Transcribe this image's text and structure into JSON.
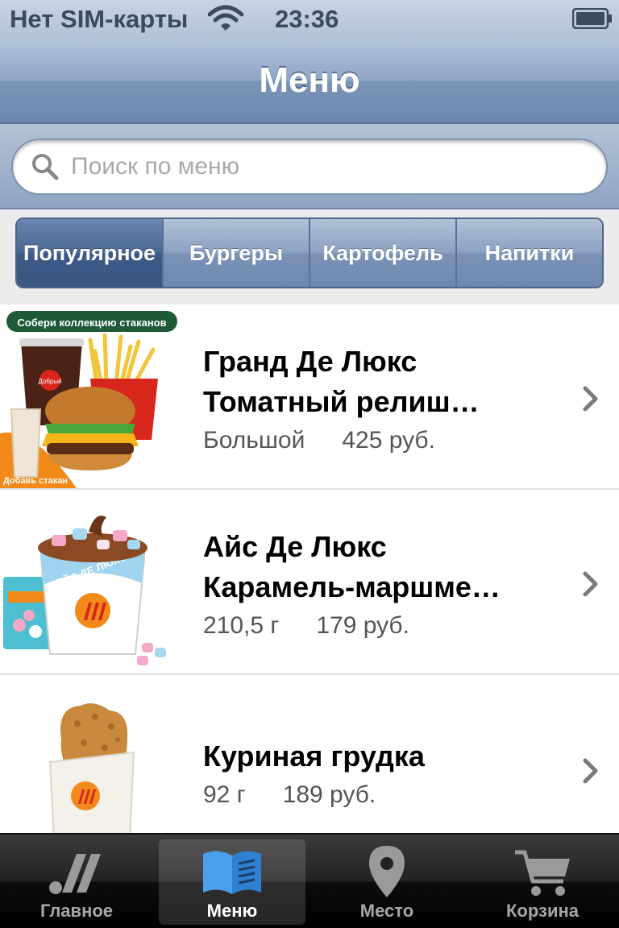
{
  "status": {
    "carrier": "Нет SIM-карты",
    "time": "23:36"
  },
  "nav": {
    "title": "Меню"
  },
  "search": {
    "placeholder": "Поиск по меню"
  },
  "segments": [
    {
      "label": "Популярное",
      "active": true
    },
    {
      "label": "Бургеры",
      "active": false
    },
    {
      "label": "Картофель",
      "active": false
    },
    {
      "label": "Напитки",
      "active": false
    }
  ],
  "items": [
    {
      "name_line1": "Гранд Де Люкс",
      "name_line2": "Томатный релиш…",
      "size": "Большой",
      "price": "425 руб.",
      "promo_top": "Собери коллекцию стаканов",
      "promo_bottom": "Добавь стакан",
      "logo_text": "Добрый"
    },
    {
      "name_line1": "Айс Де Люкс",
      "name_line2": "Карамель-маршме…",
      "size": "210,5 г",
      "price": "179 руб.",
      "cup_text": "АЙС ДЕ ЛЮКС"
    },
    {
      "name_line1": "Куриная грудка",
      "size": "92 г",
      "price": "189 руб."
    }
  ],
  "tabs": [
    {
      "label": "Главное",
      "icon": "brand-logo-icon"
    },
    {
      "label": "Меню",
      "icon": "menu-book-icon",
      "active": true
    },
    {
      "label": "Место",
      "icon": "location-pin-icon"
    },
    {
      "label": "Корзина",
      "icon": "cart-icon"
    }
  ],
  "colors": {
    "nav_blue": "#7b95b8",
    "segment_active": "#3e5a88",
    "tab_active_icon": "#3b8fe0"
  }
}
